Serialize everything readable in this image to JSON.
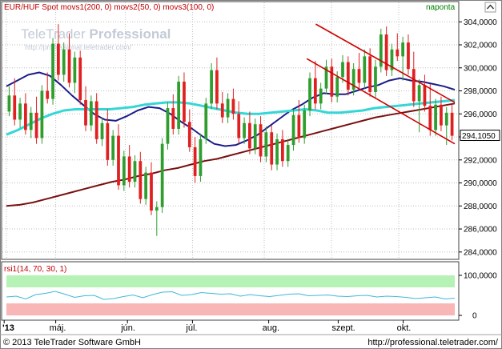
{
  "header": {
    "instrument": "EUR/HUF Spot",
    "indicators": [
      "movs1(200, 0)",
      "movs2(50, 0)",
      "movs3(100, 0)"
    ],
    "period": "naponta"
  },
  "watermark": {
    "brand_light": "TeleTrader",
    "brand_bold": "Professional",
    "url": "http://professional.teletrader.com/"
  },
  "colors": {
    "panel_bg": "#ffffff",
    "frame": "#000000",
    "up_candle": "#2f9e2f",
    "down_candle": "#e02020",
    "movs1": "#7a1010",
    "movs2": "#1c1c8a",
    "movs3": "#36d6d6",
    "channel": "#d00000",
    "rsi_line": "#3fb8d8",
    "rsi_upper_band": "#b6f2b6",
    "rsi_lower_band": "#f9b6b6",
    "header_title": "#c00000",
    "period_label": "#008000",
    "price_marker_bg": "#ffffff"
  },
  "chart_data": [
    {
      "type": "candlestick",
      "title": "EUR/HUF Spot",
      "ylim": [
        283.5,
        305.2
      ],
      "yticks": [
        284,
        286,
        288,
        290,
        292,
        294,
        296,
        298,
        300,
        302,
        304
      ],
      "ytick_labels": [
        "284,0000",
        "286,0000",
        "288,0000",
        "290,0000",
        "292,0000",
        "294,0000",
        "296,0000",
        "298,0000",
        "300,0000",
        "302,0000",
        "304,0000"
      ],
      "last_price_label": "294,1050",
      "last_price": 294.105,
      "x_labels": [
        "'13",
        "máj.",
        "jún.",
        "júl.",
        "aug.",
        "szept.",
        "okt."
      ],
      "grid": true,
      "candles": [
        [
          296.2,
          298.4,
          295.8,
          297.6
        ],
        [
          297.6,
          299.1,
          295.0,
          295.5
        ],
        [
          295.5,
          297.4,
          294.8,
          296.9
        ],
        [
          296.9,
          297.8,
          294.2,
          294.6
        ],
        [
          294.6,
          296.6,
          293.9,
          296.1
        ],
        [
          296.1,
          297.5,
          293.4,
          293.9
        ],
        [
          293.9,
          298.5,
          293.4,
          298.0
        ],
        [
          298.0,
          299.6,
          296.9,
          297.3
        ],
        [
          297.3,
          302.6,
          296.8,
          302.1
        ],
        [
          302.1,
          303.8,
          298.9,
          299.4
        ],
        [
          299.4,
          302.2,
          298.8,
          301.6
        ],
        [
          301.6,
          303.0,
          298.3,
          298.7
        ],
        [
          298.7,
          301.4,
          297.8,
          300.9
        ],
        [
          300.9,
          301.5,
          296.8,
          297.2
        ],
        [
          297.2,
          298.4,
          294.5,
          295.0
        ],
        [
          295.0,
          297.6,
          294.5,
          297.1
        ],
        [
          297.1,
          297.8,
          293.4,
          293.8
        ],
        [
          293.8,
          295.7,
          293.2,
          295.2
        ],
        [
          295.2,
          296.4,
          291.5,
          292.0
        ],
        [
          292.0,
          294.6,
          291.5,
          294.1
        ],
        [
          294.1,
          295.1,
          289.4,
          289.8
        ],
        [
          289.8,
          292.8,
          289.3,
          292.3
        ],
        [
          292.3,
          293.3,
          289.6,
          290.1
        ],
        [
          290.1,
          292.4,
          289.6,
          291.9
        ],
        [
          291.9,
          292.7,
          288.2,
          288.6
        ],
        [
          288.6,
          291.4,
          288.1,
          290.9
        ],
        [
          290.9,
          291.8,
          287.2,
          287.6
        ],
        [
          287.6,
          288.4,
          285.4,
          287.9
        ],
        [
          287.9,
          293.9,
          287.4,
          293.4
        ],
        [
          293.4,
          297.0,
          292.9,
          296.5
        ],
        [
          296.5,
          297.7,
          294.2,
          294.7
        ],
        [
          294.7,
          299.3,
          294.2,
          298.8
        ],
        [
          298.8,
          299.6,
          294.8,
          295.3
        ],
        [
          295.3,
          296.4,
          292.7,
          293.1
        ],
        [
          293.1,
          294.0,
          290.0,
          290.6
        ],
        [
          290.6,
          294.3,
          290.1,
          293.8
        ],
        [
          293.8,
          297.4,
          293.4,
          296.9
        ],
        [
          296.9,
          300.4,
          296.4,
          299.8
        ],
        [
          299.8,
          300.9,
          296.4,
          296.9
        ],
        [
          296.9,
          297.9,
          295.2,
          295.7
        ],
        [
          295.7,
          297.8,
          295.2,
          297.3
        ],
        [
          297.3,
          298.2,
          295.5,
          296.0
        ],
        [
          296.0,
          297.1,
          293.4,
          293.9
        ],
        [
          293.9,
          295.7,
          293.4,
          295.2
        ],
        [
          295.2,
          296.2,
          292.5,
          293.0
        ],
        [
          293.0,
          295.6,
          292.5,
          295.1
        ],
        [
          295.1,
          295.8,
          291.8,
          292.3
        ],
        [
          292.3,
          294.9,
          291.8,
          294.4
        ],
        [
          294.4,
          295.0,
          291.1,
          291.6
        ],
        [
          291.6,
          294.3,
          291.1,
          293.8
        ],
        [
          293.8,
          294.6,
          291.4,
          291.9
        ],
        [
          291.9,
          293.8,
          291.4,
          293.3
        ],
        [
          293.3,
          296.4,
          292.8,
          295.9
        ],
        [
          295.9,
          297.2,
          293.5,
          293.9
        ],
        [
          293.9,
          296.8,
          293.4,
          296.3
        ],
        [
          296.3,
          299.6,
          295.8,
          299.1
        ],
        [
          299.1,
          300.6,
          296.4,
          296.9
        ],
        [
          296.9,
          298.7,
          296.4,
          298.2
        ],
        [
          298.2,
          300.7,
          297.7,
          300.1
        ],
        [
          300.1,
          300.8,
          297.0,
          297.5
        ],
        [
          297.5,
          299.7,
          297.0,
          299.2
        ],
        [
          299.2,
          301.1,
          298.7,
          300.5
        ],
        [
          300.5,
          301.0,
          297.6,
          298.1
        ],
        [
          298.1,
          300.4,
          297.6,
          299.9
        ],
        [
          299.9,
          301.3,
          298.2,
          298.7
        ],
        [
          298.7,
          301.6,
          298.2,
          301.0
        ],
        [
          301.0,
          301.7,
          297.5,
          297.9
        ],
        [
          297.9,
          300.7,
          297.4,
          300.1
        ],
        [
          300.1,
          303.4,
          299.6,
          302.9
        ],
        [
          302.9,
          303.6,
          299.3,
          299.8
        ],
        [
          299.8,
          302.1,
          299.3,
          301.6
        ],
        [
          301.6,
          303.0,
          300.6,
          301.0
        ],
        [
          301.0,
          302.7,
          298.9,
          302.2
        ],
        [
          302.2,
          302.9,
          299.4,
          299.9
        ],
        [
          299.9,
          301.4,
          296.6,
          297.1
        ],
        [
          297.1,
          299.0,
          294.4,
          298.5
        ],
        [
          298.5,
          299.4,
          296.2,
          296.7
        ],
        [
          296.7,
          298.6,
          294.1,
          294.6
        ],
        [
          294.6,
          297.3,
          294.1,
          296.8
        ],
        [
          296.8,
          297.5,
          294.5,
          295.0
        ],
        [
          295.0,
          296.6,
          293.3,
          296.1
        ],
        [
          296.1,
          296.8,
          293.7,
          294.1
        ]
      ],
      "series": [
        {
          "name": "movs1(200, 0)",
          "values": [
            288.0,
            288.1,
            288.3,
            288.6,
            288.9,
            289.2,
            289.5,
            289.8,
            290.1,
            290.3,
            290.6,
            290.8,
            291.1,
            291.3,
            291.6,
            291.9,
            292.1,
            292.4,
            292.7,
            293.0,
            293.3,
            293.6,
            293.9,
            294.2,
            294.5,
            294.8,
            295.1,
            295.4,
            295.7,
            295.9,
            296.1,
            296.3,
            296.5,
            296.7,
            296.9
          ]
        },
        {
          "name": "movs2(50, 0)",
          "values": [
            298.4,
            298.9,
            299.4,
            299.6,
            299.3,
            298.5,
            297.6,
            296.8,
            296.0,
            295.5,
            295.4,
            295.8,
            296.3,
            296.6,
            296.5,
            296.0,
            295.3,
            294.7,
            294.0,
            293.4,
            293.2,
            293.3,
            293.7,
            294.2,
            294.9,
            295.6,
            296.3,
            296.8,
            297.4,
            297.8,
            297.7,
            297.7,
            298.0,
            298.3,
            298.5,
            298.9,
            299.1,
            298.9,
            298.8,
            298.6,
            298.4,
            298.1
          ]
        },
        {
          "name": "movs3(100, 0)",
          "values": [
            294.2,
            294.6,
            295.1,
            295.6,
            296.0,
            296.3,
            296.4,
            296.4,
            296.4,
            296.4,
            296.5,
            296.6,
            296.8,
            296.9,
            297.0,
            297.0,
            296.9,
            296.7,
            296.5,
            296.3,
            296.1,
            296.0,
            296.0,
            296.1,
            296.2,
            296.3,
            296.4,
            296.3,
            296.1,
            296.1,
            296.2,
            296.3,
            296.5,
            296.6,
            296.7,
            296.8,
            296.9,
            297.0,
            297.1,
            297.2
          ]
        }
      ],
      "trend_channel": {
        "upper": [
          [
            0.69,
            303.8
          ],
          [
            1.0,
            297.0
          ]
        ],
        "lower": [
          [
            0.67,
            300.8
          ],
          [
            1.0,
            293.4
          ]
        ]
      }
    },
    {
      "type": "line",
      "title": "rsi1(14, 70, 30, 1)",
      "ylim": [
        0,
        100
      ],
      "yticks": [
        0,
        100
      ],
      "ytick_labels": [
        "0",
        "100,0000"
      ],
      "bands": {
        "upper": [
          70,
          100
        ],
        "lower": [
          0,
          30
        ]
      },
      "series": [
        {
          "name": "rsi1(14, 70, 30, 1)",
          "values": [
            46,
            48,
            41,
            52,
            55,
            60,
            53,
            45,
            49,
            50,
            40,
            42,
            47,
            51,
            44,
            52,
            58,
            59,
            50,
            52,
            57,
            55,
            53,
            54,
            48,
            52,
            49,
            47,
            50,
            53,
            54,
            49,
            50,
            51,
            48,
            47,
            49,
            50,
            46,
            48,
            47,
            45,
            42,
            44,
            46,
            41,
            43
          ]
        }
      ]
    }
  ],
  "footer": {
    "copyright": "© 2013 TeleTrader Software GmbH",
    "url": "http://professional.teletrader.com/"
  }
}
